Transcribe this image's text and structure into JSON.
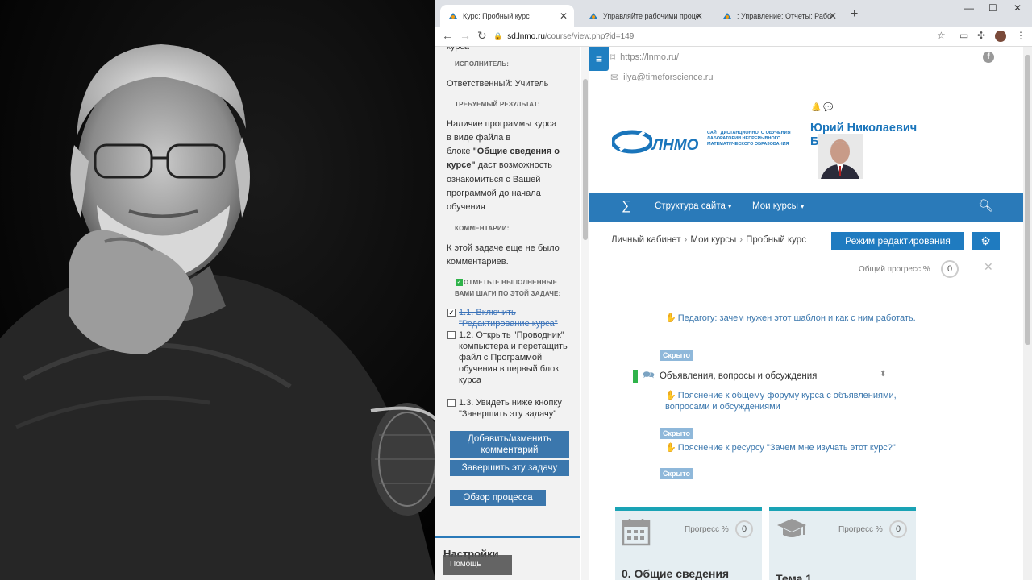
{
  "tabs": [
    {
      "title": "Курс: Пробный курс"
    },
    {
      "title": "Управляйте рабочими процесс"
    },
    {
      "title": ": Управление: Отчеты: Рабочи"
    }
  ],
  "url": {
    "host": "sd.lnmo.ru",
    "path": "/course/view.php?id=149"
  },
  "drawer": {
    "top_text": "курса",
    "executor_label": "ИСПОЛНИТЕЛЬ:",
    "executor_value": "Ответственный: Учитель",
    "result_label": "ТРЕБУЕМЫЙ РЕЗУЛЬТАТ:",
    "result_text_1": "Наличие  программы курса",
    "result_text_2": "в виде файла в",
    "result_text_3": "блоке",
    "result_bold_1": "\"Общие сведения о",
    "result_bold_2": "курсе\"",
    "result_text_4": "даст возможность",
    "result_text_5": "ознакомиться с Вашей",
    "result_text_6": "программой до начала",
    "result_text_7": "обучения",
    "comments_label": "КОММЕНТАРИИ:",
    "comments_text_1": "К этой задаче еще не было",
    "comments_text_2": "комментариев.",
    "steps_label_1": "ОТМЕТЬТЕ ВЫПОЛНЕННЫЕ",
    "steps_label_2": "ВАМИ ШАГИ ПО ЭТОЙ ЗАДАЧЕ:",
    "steps": [
      {
        "text": "1.1. Включить \"Редактирование курса\"",
        "done": true
      },
      {
        "text": "1.2. Открыть \"Проводник\" компьютера и перетащить файл с Программой обучения в первый блок курса",
        "done": false
      },
      {
        "text": "1.3. Увидеть ниже кнопку \"Завершить эту задачу\"",
        "done": false
      }
    ],
    "btn_comment": "Добавить/изменить комментарий",
    "btn_complete": "Завершить эту задачу",
    "btn_overview": "Обзор процесса",
    "settings_title": "Настройки",
    "help_label": "Помощь"
  },
  "header": {
    "site_url": "https://lnmo.ru/",
    "email": "ilya@timeforscience.ru",
    "logo_name": "ЛНМО",
    "logo_tagline": "САЙТ ДИСТАНЦИОННОГО ОБУЧЕНИЯ ЛАБОРАТОРИИ НЕПРЕРЫВНОГО МАТЕМАТИЧЕСКОГО ОБРАЗОВАНИЯ",
    "user_first": "Юрий Николаевич",
    "user_last": "Б      кин"
  },
  "nav": {
    "site_structure": "Структура сайта",
    "my_courses": "Мои курсы"
  },
  "breadcrumb": [
    "Личный кабинет",
    "Мои курсы",
    "Пробный курс"
  ],
  "edit_mode": "Режим редактирования",
  "overall_progress_label": "Общий прогресс %",
  "overall_progress_value": "0",
  "content": {
    "link1": "Педагогу: зачем нужен этот шаблон и как с ним работать.",
    "hidden": "Скрыто",
    "forum": "Объявления, вопросы и обсуждения",
    "link2": "Пояснение к общему форуму курса с объявлениями, вопросами и обсуждениями",
    "link3": "Пояснение к ресурсу \"Зачем мне изучать этот курс?\""
  },
  "cards": [
    {
      "progress_label": "Прогресс %",
      "progress_value": "0",
      "title": "0. Общие сведения"
    },
    {
      "progress_label": "Прогресс %",
      "progress_value": "0",
      "title": "Тема 1"
    }
  ],
  "colors": {
    "accent": "#2a7ab9",
    "hidden_badge": "#8fb8da",
    "card_top": "#1aa3b5"
  }
}
